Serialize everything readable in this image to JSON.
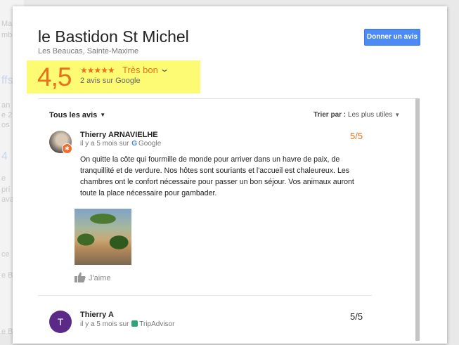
{
  "background": {
    "fragments": [
      "Ma",
      "mb",
      "ffs",
      "an",
      "e 2",
      "os",
      "4",
      "e",
      "pri",
      "ava",
      "ce",
      "e B",
      "e B"
    ]
  },
  "place": {
    "name": "le Bastidon St Michel",
    "address": "Les Beaucas, Sainte-Maxime",
    "write_review_label": "Donner un avis"
  },
  "rating": {
    "value": "4,5",
    "stars_text": "★★★★★",
    "stars_value": 4.5,
    "quality_label": "Très bon",
    "review_count_text": "2 avis sur Google"
  },
  "reviews_header": {
    "filter_label": "Tous les avis",
    "sort_label": "Trier par :",
    "sort_value": "Les plus utiles"
  },
  "reviews": [
    {
      "author": "Thierry ARNAVIELHE",
      "time": "il y a 5 mois sur",
      "source": "Google",
      "score": "5/5",
      "text": "On quitte la côte qui fourmille de monde pour arriver dans un havre de paix, de tranquillité et de verdure. Nos hôtes sont souriants et l'accueil est chaleureux. Les chambres ont le confort nécessaire pour passer un bon séjour. Vos animaux auront toute la place nécessaire pour gambader.",
      "like_label": "J'aime"
    },
    {
      "author": "Thierry A",
      "avatar_initial": "T",
      "time": "il y a 5 mois sur",
      "source": "TripAdvisor",
      "score": "5/5"
    }
  ],
  "colors": {
    "accent_orange": "#e7711b",
    "button_blue": "#4c8bf5",
    "highlight_yellow": "#fdfb73",
    "avatar_purple": "#5b2a86"
  }
}
